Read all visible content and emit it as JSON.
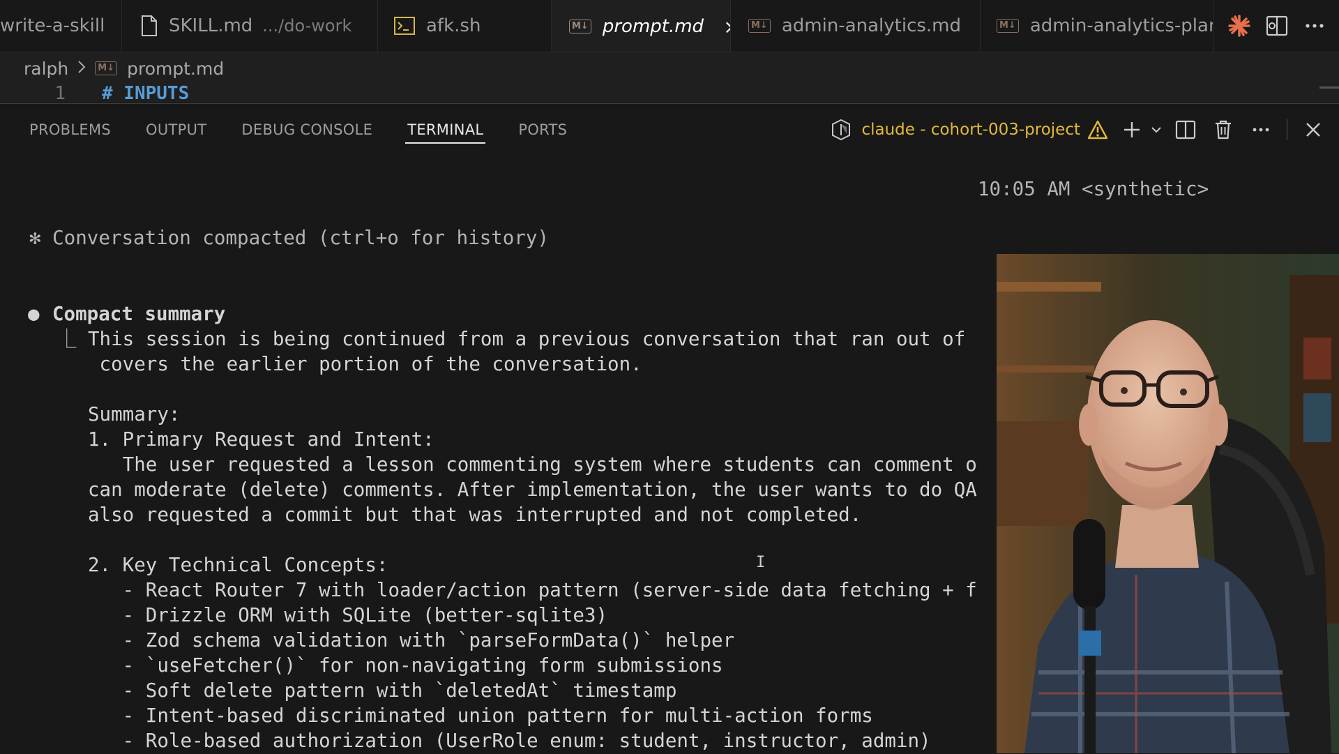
{
  "tabs": [
    {
      "label": "write-a-skill",
      "path": "",
      "icon": "markdown-icon",
      "active": false
    },
    {
      "label": "SKILL.md",
      "path": ".../do-work",
      "icon": "file-icon",
      "active": false
    },
    {
      "label": "afk.sh",
      "path": "",
      "icon": "terminal-file-icon",
      "active": false
    },
    {
      "label": "prompt.md",
      "path": "",
      "icon": "markdown-icon",
      "active": true
    },
    {
      "label": "admin-analytics.md",
      "path": "",
      "icon": "markdown-icon",
      "active": false
    },
    {
      "label": "admin-analytics-plan.md",
      "path": "",
      "icon": "markdown-icon",
      "active": false
    }
  ],
  "md_badge": "M↓",
  "tab_close_glyph": "×",
  "tab_actions": [
    "claude-spark-icon",
    "split-editor-icon",
    "more-actions-icon"
  ],
  "breadcrumb": {
    "folder": "ralph",
    "file": "prompt.md"
  },
  "editor": {
    "line_number": "1",
    "line_text": "# INPUTS"
  },
  "panel": {
    "tabs": [
      "PROBLEMS",
      "OUTPUT",
      "DEBUG CONSOLE",
      "TERMINAL",
      "PORTS"
    ],
    "active_tab": "TERMINAL",
    "terminal_name": "claude - cohort-003-project",
    "accent_color": "#e2b93d"
  },
  "terminal": {
    "timestamp": "10:05 AM <synthetic>",
    "compacted": "✻ Conversation compacted (ctrl+o for history)",
    "bullet": "●",
    "summary_title": "Compact summary",
    "tree_glyph": "⎿",
    "lines": [
      "This session is being continued from a previous conversation that ran out of",
      " covers the earlier portion of the conversation.",
      "",
      "Summary:",
      "1. Primary Request and Intent:",
      "   The user requested a lesson commenting system where students can comment o",
      "can moderate (delete) comments. After implementation, the user wants to do QA",
      "also requested a commit but that was interrupted and not completed.",
      "",
      "2. Key Technical Concepts:",
      "   - React Router 7 with loader/action pattern (server-side data fetching + f",
      "   - Drizzle ORM with SQLite (better-sqlite3)",
      "   - Zod schema validation with `parseFormData()` helper",
      "   - `useFetcher()` for non-navigating form submissions",
      "   - Soft delete pattern with `deletedAt` timestamp",
      "   - Intent-based discriminated union pattern for multi-action forms",
      "   - Role-based authorization (UserRole enum: student, instructor, admin)"
    ]
  }
}
